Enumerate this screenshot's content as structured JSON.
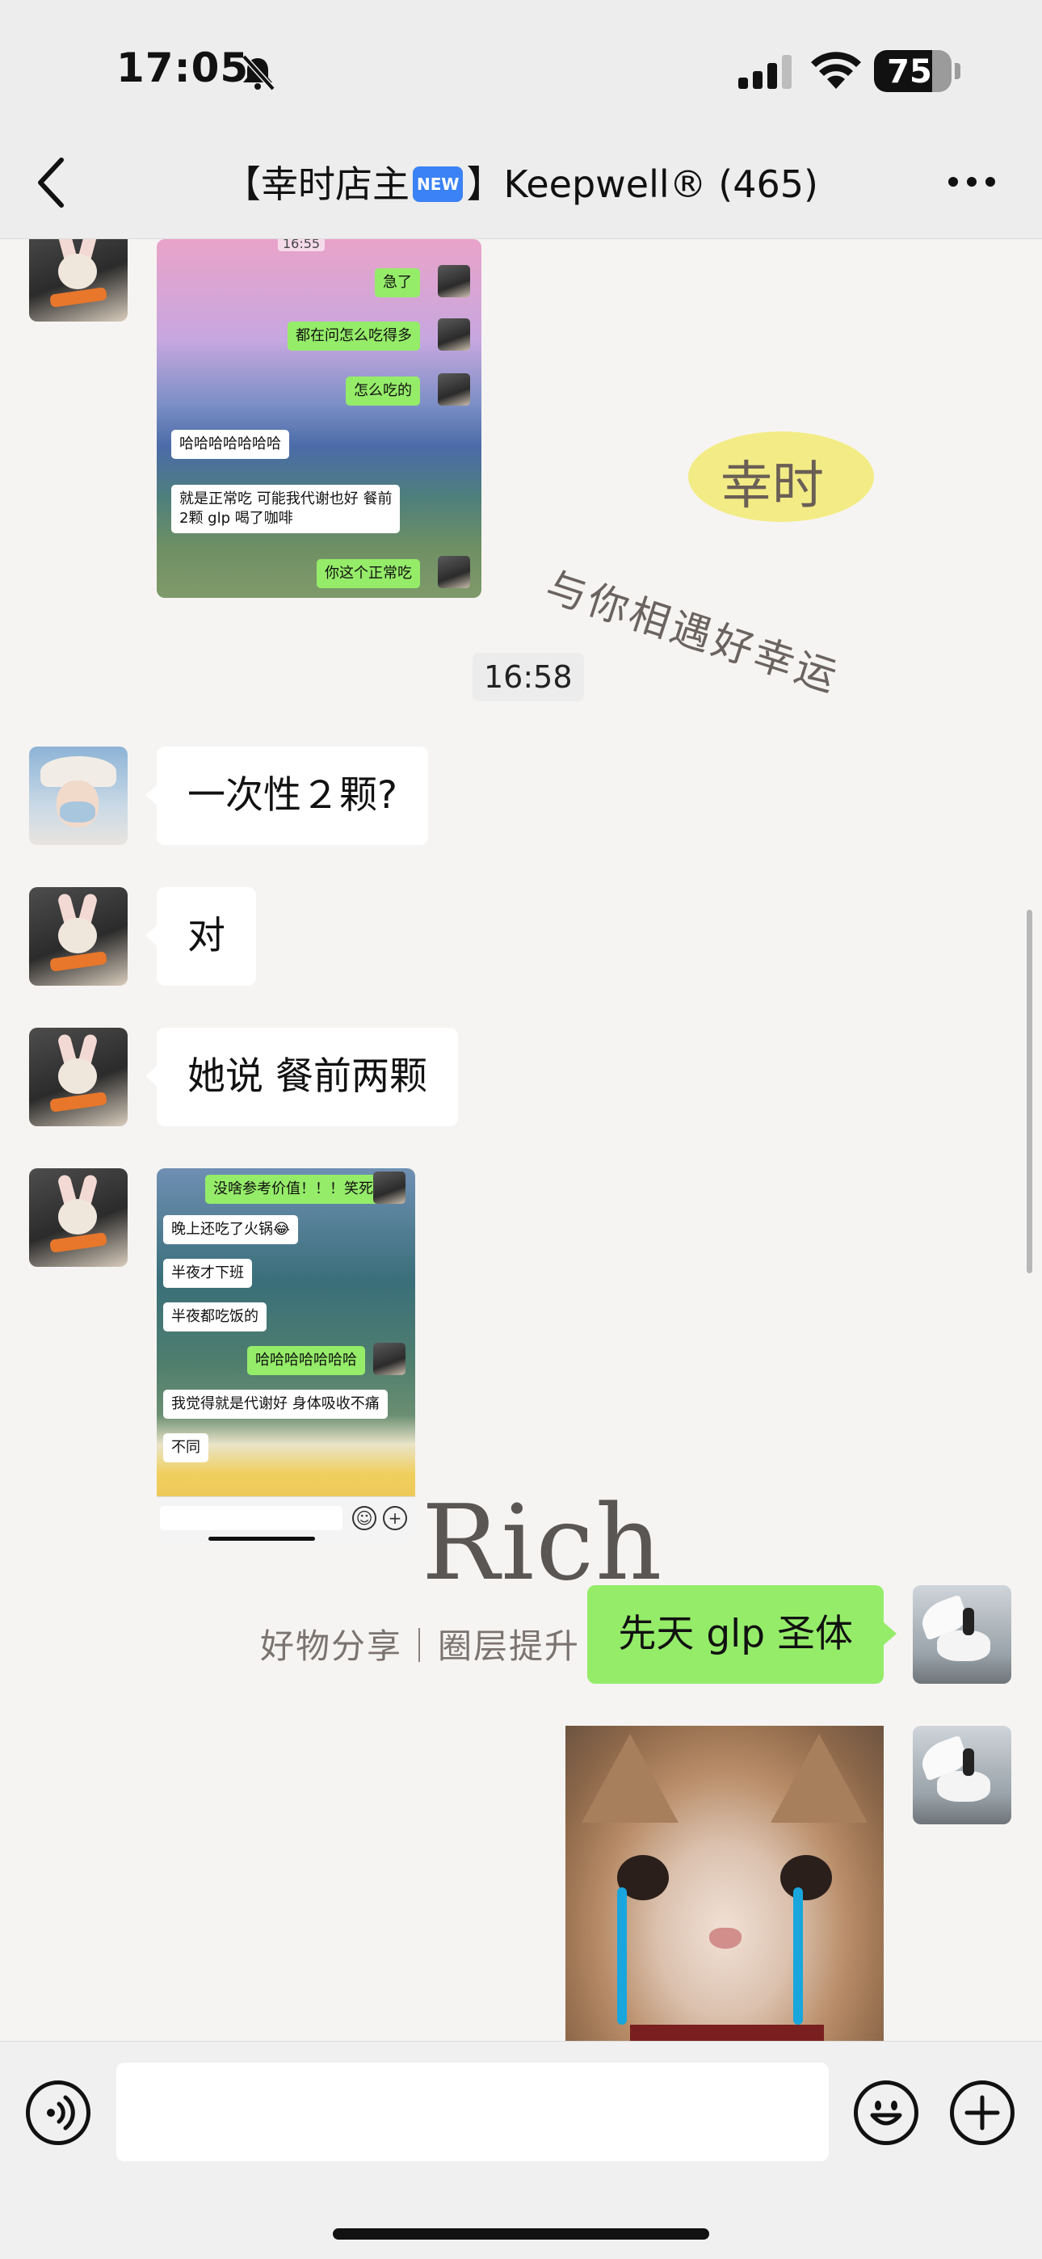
{
  "status_bar": {
    "time": "17:05",
    "battery": "75",
    "battery_level": 0.75
  },
  "header": {
    "title_prefix": "【幸时店主",
    "new_badge": "NEW",
    "title_suffix": "】Keepwell® (465)"
  },
  "chat": {
    "shot1": {
      "time": "16:55",
      "messages": [
        "急了",
        "都在问怎么吃得多",
        "怎么吃的",
        "哈哈哈哈哈哈哈",
        "就是正常吃  可能我代谢也好  餐前",
        "2颗 glp  喝了咖啡",
        "你这个正常吃"
      ]
    },
    "time_separator": "16:58",
    "messages": [
      {
        "text": "一次性２颗?"
      },
      {
        "text": "对"
      },
      {
        "text": "她说 餐前两颗"
      }
    ],
    "shot2": {
      "messages": [
        "没啥参考价值！！！笑死",
        "晚上还吃了火锅😂",
        "半夜才下班",
        "半夜都吃饭的",
        "哈哈哈哈哈哈哈",
        "我觉得就是代谢好  身体吸收不痛",
        "不同"
      ]
    },
    "outgoing": {
      "text": "先天 glp 圣体"
    }
  },
  "watermarks": {
    "brand": "幸时",
    "slogan": "与你相遇好幸运",
    "rich": "Rich",
    "tagline": "好物分享｜圈层提升"
  },
  "icons": {
    "back": "chevron-left-icon",
    "more": "more-dots-icon",
    "voice": "voice-icon",
    "emoji": "emoji-icon",
    "plus": "plus-icon"
  }
}
